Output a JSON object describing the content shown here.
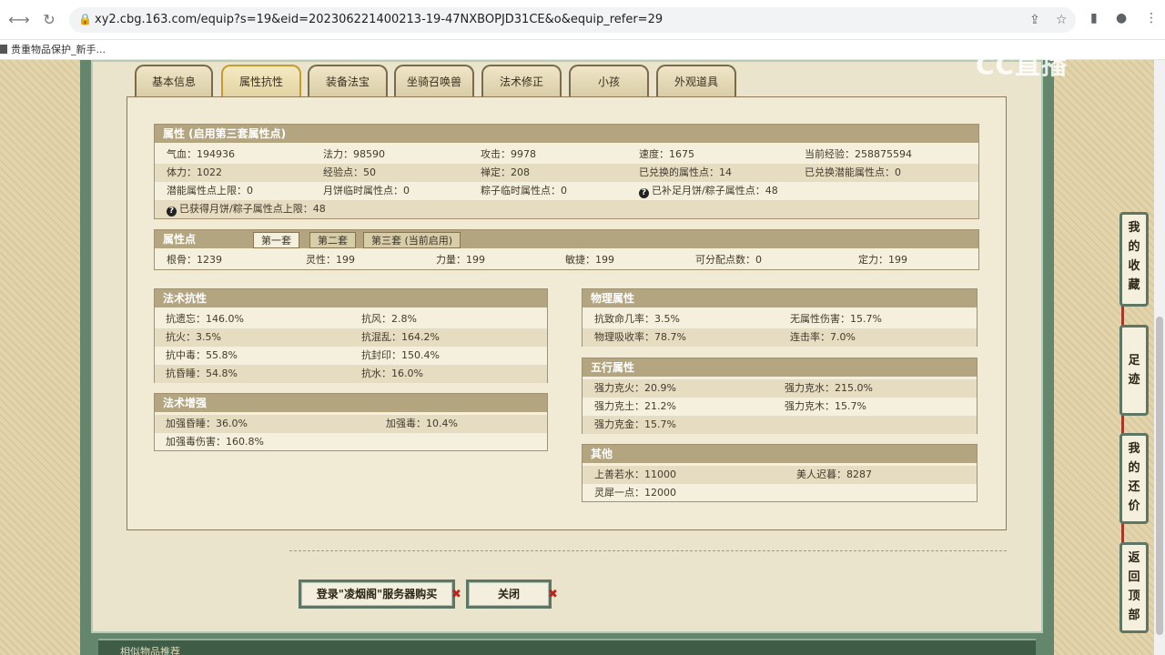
{
  "browser": {
    "url": "xy2.cbg.163.com/equip?s=19&eid=202306221400213-19-47NXBOPJD31CE&o&equip_refer=29",
    "bookmark": "贵重物品保护_新手..."
  },
  "tabs": [
    "基本信息",
    "属性抗性",
    "装备法宝",
    "坐骑召唤兽",
    "法术修正",
    "小孩",
    "外观道具"
  ],
  "attributes": {
    "title": "属性 (启用第三套属性点)",
    "rows": [
      [
        "气血：194936",
        "法力：98590",
        "攻击：9978",
        "速度：1675",
        "当前经验：258875594"
      ],
      [
        "体力：1022",
        "经验点：50",
        "禅定：208",
        "已兑换的属性点：14",
        "已兑换潜能属性点：0"
      ],
      [
        "潜能属性点上限：0",
        "月饼临时属性点：0",
        "粽子临时属性点：0",
        "已补足月饼/粽子属性点：48",
        ""
      ],
      [
        "已获得月饼/粽子属性点上限：48"
      ]
    ]
  },
  "points": {
    "title": "属性点",
    "subtabs": [
      "第一套",
      "第二套",
      "第三套 (当前启用)"
    ],
    "values": [
      "根骨：1239",
      "灵性：199",
      "力量：199",
      "敏捷：199",
      "可分配点数：0",
      "定力：199"
    ]
  },
  "spell_resist": {
    "title": "法术抗性",
    "rows": [
      [
        "抗遗忘：146.0%",
        "抗风：2.8%"
      ],
      [
        "抗火：3.5%",
        "抗混乱：164.2%"
      ],
      [
        "抗中毒：55.8%",
        "抗封印：150.4%"
      ],
      [
        "抗昏睡：54.8%",
        "抗水：16.0%"
      ]
    ]
  },
  "spell_boost": {
    "title": "法术增强",
    "rows": [
      [
        "加强昏睡：36.0%",
        "加强毒：10.4%"
      ],
      [
        "加强毒伤害：160.8%",
        ""
      ]
    ]
  },
  "physical": {
    "title": "物理属性",
    "rows": [
      [
        "抗致命几率：3.5%",
        "无属性伤害：15.7%"
      ],
      [
        "物理吸收率：78.7%",
        "连击率：7.0%"
      ]
    ]
  },
  "five_elements": {
    "title": "五行属性",
    "rows": [
      [
        "强力克火：20.9%",
        "强力克水：215.0%"
      ],
      [
        "强力克土：21.2%",
        "强力克木：15.7%"
      ],
      [
        "强力克金：15.7%",
        ""
      ]
    ]
  },
  "other": {
    "title": "其他",
    "rows": [
      [
        "上善若水：11000",
        "美人迟暮：8287"
      ],
      [
        "灵犀一点：12000",
        ""
      ]
    ]
  },
  "buttons": {
    "login_buy": "登录\"凌烟阁\"服务器购买",
    "close": "关闭",
    "x": "✖"
  },
  "side_nav": [
    [
      "我",
      "的",
      "收",
      "藏"
    ],
    [
      "足",
      "迹"
    ],
    [
      "我",
      "的",
      "还",
      "价"
    ],
    [
      "返",
      "回",
      "顶",
      "部"
    ]
  ],
  "bottom_band": "相似物品推荐",
  "watermark": "CC直播"
}
